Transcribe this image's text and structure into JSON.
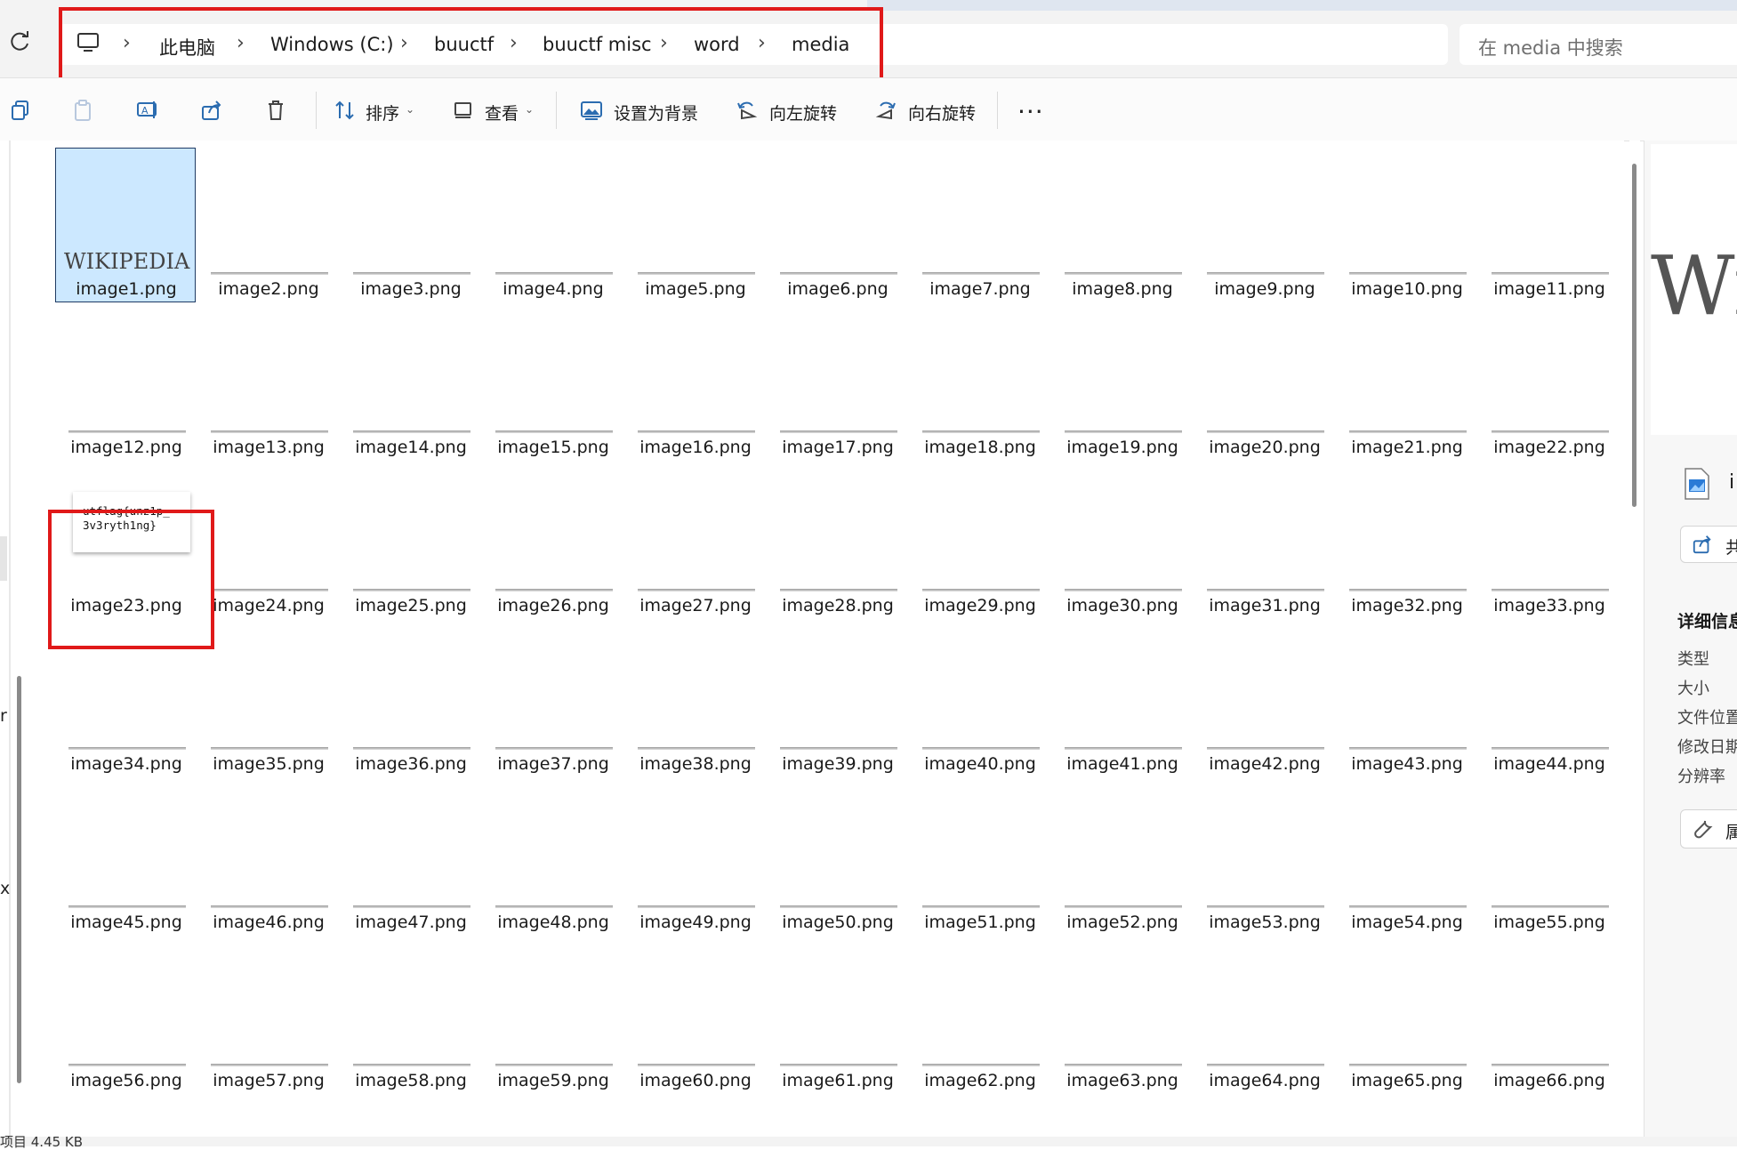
{
  "address": {
    "refresh_icon": "refresh-icon",
    "root_icon": "computer-icon",
    "breadcrumbs": [
      "此电脑",
      "Windows (C:)",
      "buuctf",
      "buuctf misc",
      "word",
      "media"
    ],
    "separator": "›",
    "search_placeholder": "在 media 中搜索"
  },
  "toolbar": {
    "sort_label": "排序",
    "view_label": "查看",
    "set_bg_label": "设置为背景",
    "rotate_left_label": "向左旋转",
    "rotate_right_label": "向右旋转",
    "more_label": "···",
    "icons": [
      "copy-icon",
      "paste-icon",
      "rename-icon",
      "share-icon",
      "delete-icon",
      "sort-icon",
      "view-icon",
      "set-background-icon",
      "rotate-left-icon",
      "rotate-right-icon"
    ]
  },
  "files": [
    "image1.png",
    "image2.png",
    "image3.png",
    "image4.png",
    "image5.png",
    "image6.png",
    "image7.png",
    "image8.png",
    "image9.png",
    "image10.png",
    "image11.png",
    "image12.png",
    "image13.png",
    "image14.png",
    "image15.png",
    "image16.png",
    "image17.png",
    "image18.png",
    "image19.png",
    "image20.png",
    "image21.png",
    "image22.png",
    "image23.png",
    "image24.png",
    "image25.png",
    "image26.png",
    "image27.png",
    "image28.png",
    "image29.png",
    "image30.png",
    "image31.png",
    "image32.png",
    "image33.png",
    "image34.png",
    "image35.png",
    "image36.png",
    "image37.png",
    "image38.png",
    "image39.png",
    "image40.png",
    "image41.png",
    "image42.png",
    "image43.png",
    "image44.png",
    "image45.png",
    "image46.png",
    "image47.png",
    "image48.png",
    "image49.png",
    "image50.png",
    "image51.png",
    "image52.png",
    "image53.png",
    "image54.png",
    "image55.png",
    "image56.png",
    "image57.png",
    "image58.png",
    "image59.png",
    "image60.png",
    "image61.png",
    "image62.png",
    "image63.png",
    "image64.png",
    "image65.png",
    "image66.png"
  ],
  "selected_file": "image1.png",
  "thumbnails": {
    "wiki_logo_text": "WIKIPEDIA",
    "flag_text": "utflag{unz1p_\n3v3ryth1ng}"
  },
  "details": {
    "preview_text": "Wi",
    "file_name_fragment": "i",
    "share_label_fragment": "共",
    "section_title": "详细信息",
    "properties": [
      "类型",
      "大小",
      "文件位置",
      "修改日期",
      "分辨率"
    ],
    "props_label_fragment": "属"
  },
  "leftnav": {
    "fragments": [
      "r",
      "x"
    ]
  },
  "status": {
    "text": "项目 4.45 KB"
  },
  "colors": {
    "highlight_red": "#e01919",
    "selection_bg": "#cce8ff"
  }
}
